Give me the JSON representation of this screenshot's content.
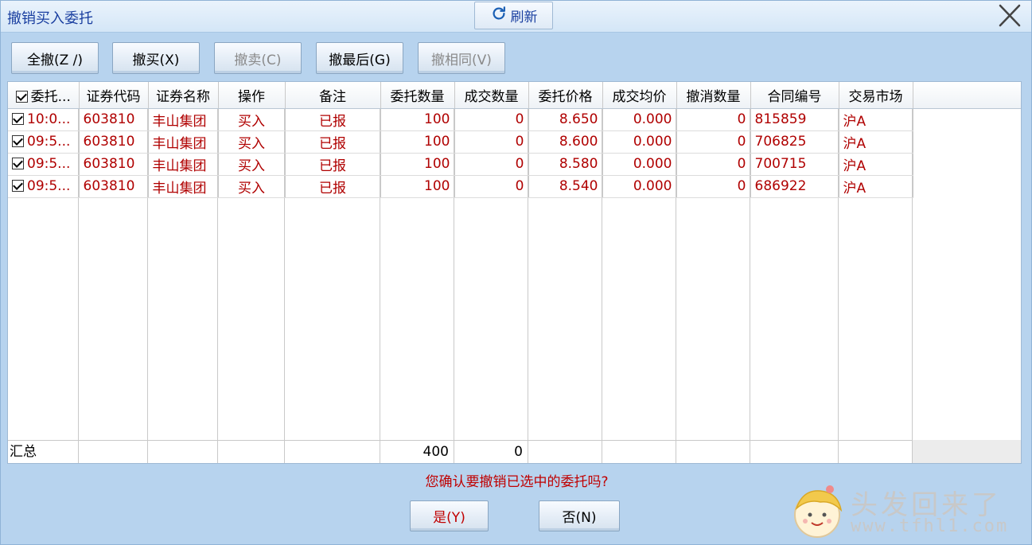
{
  "window": {
    "title": "撤销买入委托",
    "refresh_label": "刷新"
  },
  "toolbar": {
    "cancel_all": "全撤(Z /)",
    "cancel_buy": "撤买(X)",
    "cancel_sell": "撤卖(C)",
    "cancel_last": "撤最后(G)",
    "cancel_same": "撤相同(V)"
  },
  "table": {
    "headers": [
      "委托...",
      "证券代码",
      "证券名称",
      "操作",
      "备注",
      "委托数量",
      "成交数量",
      "委托价格",
      "成交均价",
      "撤消数量",
      "合同编号",
      "交易市场"
    ],
    "rows": [
      {
        "time": "10:0...",
        "code": "603810",
        "name": "丰山集团",
        "op": "买入",
        "note": "已报",
        "qty": "100",
        "deal_qty": "0",
        "price": "8.650",
        "avg": "0.000",
        "cancel_qty": "0",
        "contract": "815859",
        "market": "沪A"
      },
      {
        "time": "09:5...",
        "code": "603810",
        "name": "丰山集团",
        "op": "买入",
        "note": "已报",
        "qty": "100",
        "deal_qty": "0",
        "price": "8.600",
        "avg": "0.000",
        "cancel_qty": "0",
        "contract": "706825",
        "market": "沪A"
      },
      {
        "time": "09:5...",
        "code": "603810",
        "name": "丰山集团",
        "op": "买入",
        "note": "已报",
        "qty": "100",
        "deal_qty": "0",
        "price": "8.580",
        "avg": "0.000",
        "cancel_qty": "0",
        "contract": "700715",
        "market": "沪A"
      },
      {
        "time": "09:5...",
        "code": "603810",
        "name": "丰山集团",
        "op": "买入",
        "note": "已报",
        "qty": "100",
        "deal_qty": "0",
        "price": "8.540",
        "avg": "0.000",
        "cancel_qty": "0",
        "contract": "686922",
        "market": "沪A"
      }
    ],
    "summary": {
      "label": "汇总",
      "qty_total": "400",
      "deal_total": "0"
    }
  },
  "dialog": {
    "confirm_text": "您确认要撤销已选中的委托吗?",
    "yes_label": "是(Y)",
    "no_label": "否(N)"
  },
  "watermark": {
    "line1": "头发回来了",
    "line2": "www.tfhl1.com"
  },
  "colors": {
    "row_text": "#b00000",
    "title_text": "#1a3fa0",
    "confirm_text": "#c00000"
  }
}
